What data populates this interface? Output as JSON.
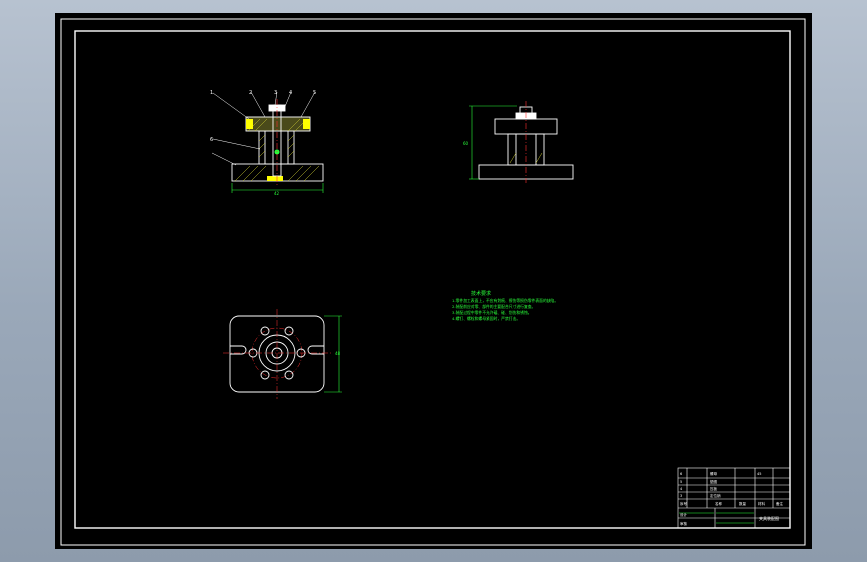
{
  "drawing": {
    "notes_title": "技术要求",
    "notes": [
      "1.零件加工表面上，不应有划痕、擦伤等损伤零件表面的缺陷。",
      "2.装配前应对零、部件的主要配合尺寸进行复查。",
      "3.装配过程中零件不允许磕、碰、划伤和锈蚀。",
      "4.螺钉、螺栓和螺母紧固时，严禁打击。"
    ],
    "front_view_balloons": [
      "1",
      "2",
      "3",
      "4",
      "5",
      "6"
    ],
    "dimension_labels": [
      "42",
      "60",
      "48"
    ]
  },
  "title_block": {
    "header": [
      "序号",
      "名称",
      "数量",
      "材料",
      "备注"
    ],
    "rows": [
      [
        "6",
        "螺母",
        "1",
        "45",
        ""
      ],
      [
        "5",
        "垫圈",
        "1",
        "45",
        ""
      ],
      [
        "4",
        "压板",
        "1",
        "45",
        ""
      ],
      [
        "3",
        "定位销",
        "1",
        "45",
        ""
      ],
      [
        "2",
        "支承座",
        "1",
        "HT200",
        ""
      ],
      [
        "1",
        "底座",
        "1",
        "HT200",
        ""
      ]
    ],
    "footer": [
      "设计",
      "审核",
      "工艺",
      "批准"
    ],
    "drawing_name": "夹具装配图"
  },
  "colors": {
    "viewport_bg": "#000000",
    "frame": "#ffffff",
    "outline": "#ffffff",
    "dimension": "#29ff3a",
    "hatch": "#c8c832",
    "center_line": "#ff3030",
    "leader": "#ffffff",
    "highlight": "#ffff00"
  }
}
